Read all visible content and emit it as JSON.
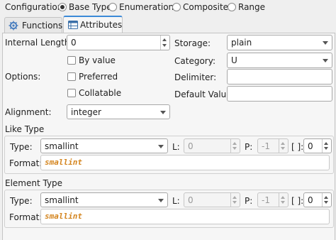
{
  "configuration": {
    "label": "Configuration:",
    "options": [
      "Base Type",
      "Enumeration",
      "Composite",
      "Range"
    ],
    "selected": "Base Type"
  },
  "tabs": [
    {
      "label": "Functions",
      "icon": "functions-icon",
      "active": false
    },
    {
      "label": "Attributes",
      "icon": "attributes-icon",
      "active": true
    }
  ],
  "attributes": {
    "internal_length": {
      "label": "Internal Length:",
      "value": "0"
    },
    "options_label": "Options:",
    "by_value": {
      "label": "By value",
      "checked": false
    },
    "preferred": {
      "label": "Preferred",
      "checked": false
    },
    "collatable": {
      "label": "Collatable",
      "checked": false
    },
    "alignment": {
      "label": "Alignment:",
      "value": "integer"
    },
    "storage": {
      "label": "Storage:",
      "value": "plain"
    },
    "category": {
      "label": "Category:",
      "value": "U"
    },
    "delimiter": {
      "label": "Delimiter:",
      "value": ""
    },
    "default_value": {
      "label": "Default Value:",
      "value": ""
    }
  },
  "like_type": {
    "title": "Like Type",
    "type_label": "Type:",
    "type_value": "smallint",
    "l_label": "L:",
    "l_value": "0",
    "p_label": "P:",
    "p_value": "-1",
    "dims_label": "[ ]:",
    "dims_value": "0",
    "format_label": "Format:",
    "format_value": "smallint"
  },
  "element_type": {
    "title": "Element Type",
    "type_label": "Type:",
    "type_value": "smallint",
    "l_label": "L:",
    "l_value": "0",
    "p_label": "P:",
    "p_value": "-1",
    "dims_label": "[ ]:",
    "dims_value": "0",
    "format_label": "Format:",
    "format_value": "smallint"
  },
  "colors": {
    "background": "#efefef",
    "format_text": "#d4851f",
    "tab_active_border": "#3c8ad8"
  }
}
